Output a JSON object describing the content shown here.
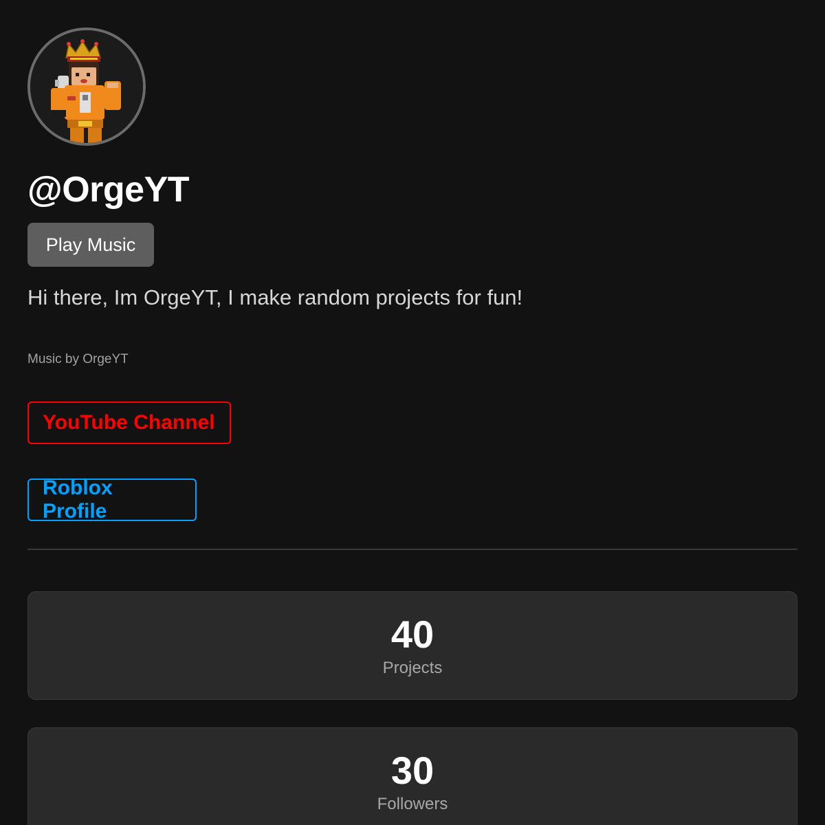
{
  "profile": {
    "avatar_alt": "OrgeYT avatar",
    "username": "@OrgeYT",
    "play_button": "Play Music",
    "bio": "Hi there, Im OrgeYT, I make random projects for fun!",
    "music_credit": "Music by OrgeYT"
  },
  "links": {
    "youtube": {
      "label": "YouTube Channel",
      "color": "#ff0000"
    },
    "roblox": {
      "label": "Roblox Profile",
      "color": "#00a2ff"
    }
  },
  "stats": [
    {
      "value": "40",
      "label": "Projects"
    },
    {
      "value": "30",
      "label": "Followers"
    }
  ],
  "theme": {
    "background": "#121212",
    "card": "#2a2a2a",
    "button": "#5e5e5e"
  }
}
